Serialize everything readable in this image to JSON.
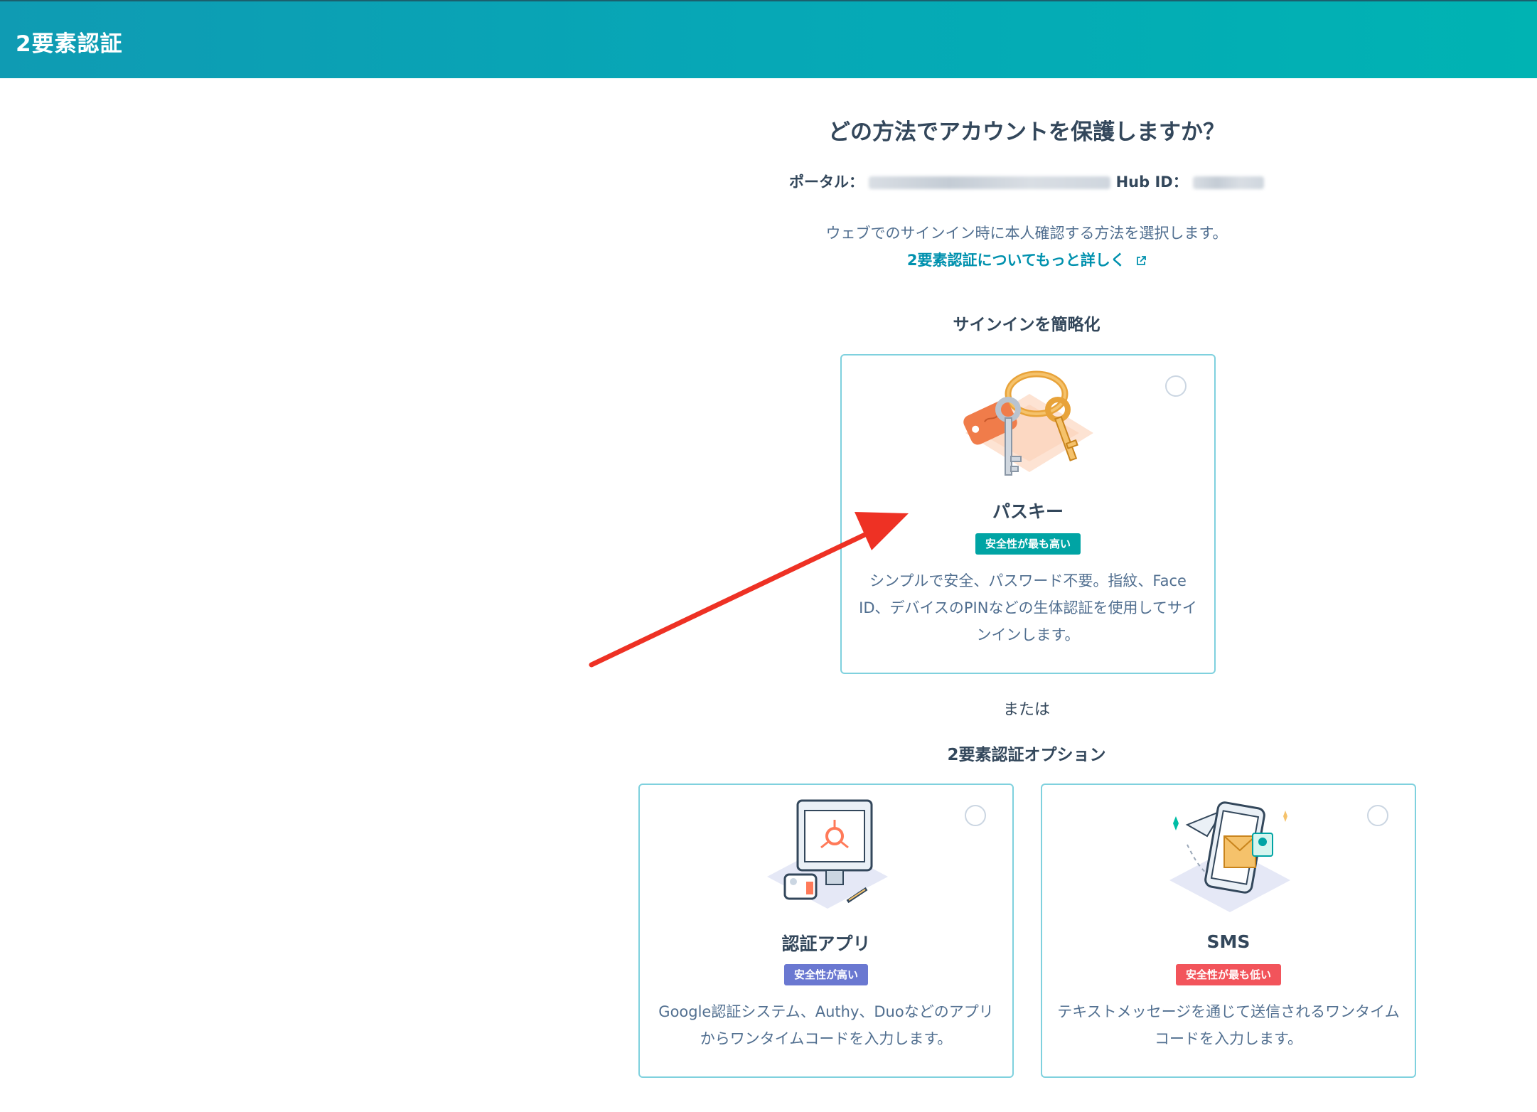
{
  "header": {
    "title": "2要素認証"
  },
  "main": {
    "heading": "どの方法でアカウントを保護しますか？",
    "portal_label": "ポータル：",
    "hub_label": "Hub ID：",
    "description": "ウェブでのサインイン時に本人確認する方法を選択します。",
    "learn_more": "2要素認証についてもっと詳しく",
    "simplify_title": "サインインを簡略化",
    "or_text": "または",
    "options_title": "2要素認証オプション"
  },
  "cards": {
    "passkey": {
      "title": "パスキー",
      "badge": "安全性が最も高い",
      "text": "シンプルで安全、パスワード不要。指紋、Face ID、デバイスのPINなどの生体認証を使用してサインインします。",
      "badge_color": "#00a4a4"
    },
    "authapp": {
      "title": "認証アプリ",
      "badge": "安全性が高い",
      "text": "Google認証システム、Authy、Duoなどのアプリからワンタイムコードを入力します。",
      "badge_color": "#6a78d1"
    },
    "sms": {
      "title": "SMS",
      "badge": "安全性が最も低い",
      "text": "テキストメッセージを通じて送信されるワンタイムコードを入力します。",
      "badge_color": "#f2545b"
    }
  },
  "colors": {
    "accent": "#0091ae",
    "annotation_arrow": "#ee3124"
  }
}
